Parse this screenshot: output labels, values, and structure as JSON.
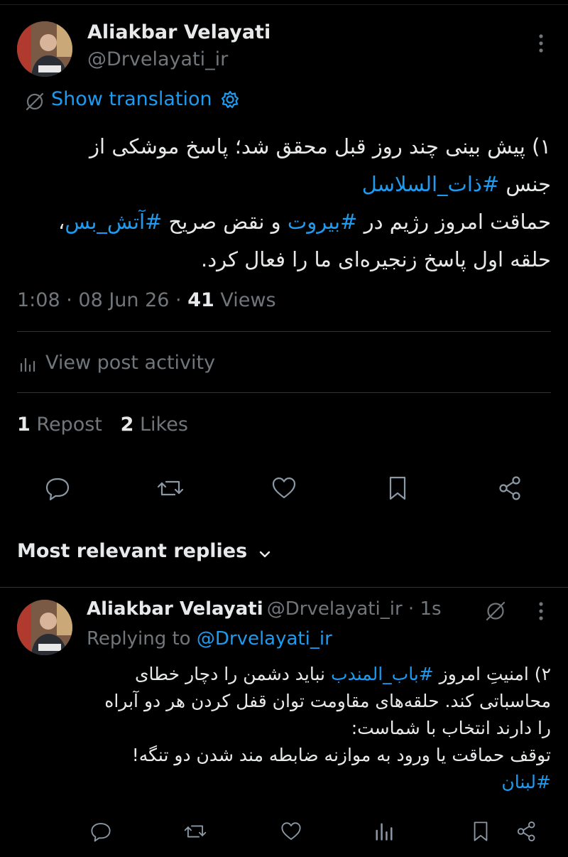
{
  "post": {
    "author_name": "Aliakbar Velayati",
    "author_handle": "@Drvelayati_ir",
    "show_translation": "Show translation",
    "text": {
      "line1": "۱) پیش بینی چند روز قبل محقق شد؛ پاسخ موشکی از",
      "line2_prefix": "جنس ",
      "line2_hashtag": "#ذات_السلاسل",
      "line3_a": "حماقت امروز رژیم در ",
      "line3_hashtag1": "#بیروت",
      "line3_b": " و نقض صریح ",
      "line3_hashtag2": "#آتش_بس",
      "line3_c": "،",
      "line4": "حلقه اول پاسخ زنجیره‌ای ما را فعال کرد."
    },
    "time": "1:08",
    "date": "08 Jun 26",
    "views_count": "41",
    "views_label": "Views",
    "view_activity": "View post activity",
    "repost_count": "1",
    "repost_label": "Repost",
    "likes_count": "2",
    "likes_label": "Likes"
  },
  "replies_header": {
    "label": "Most relevant replies"
  },
  "reply": {
    "author_name": "Aliakbar Velayati",
    "author_handle": "@Drvelayati_ir",
    "time": "1s",
    "replying_to_label": "Replying to",
    "replying_to_handle": "@Drvelayati_ir",
    "text": {
      "line1_a": "۲) امنیتِ امروز ",
      "line1_hashtag": "#باب_المندب",
      "line1_b": " نباید دشمن را دچار خطای",
      "line2": "محاسباتی کند. حلقه‌های مقاومت توان قفل کردن هر دو آبراه",
      "line3": "را دارند انتخاب با شماست:",
      "line4": "توقف حماقت یا ورود به موازنه ضابطه مند شدن دو تنگه!",
      "line5_hashtag": "#لبنان"
    }
  },
  "icons": {
    "more": "more-icon",
    "translate": "translate-icon",
    "settings": "gear-icon",
    "analytics": "analytics-icon",
    "reply": "reply-icon",
    "repost": "repost-icon",
    "like": "heart-icon",
    "bookmark": "bookmark-icon",
    "share": "share-icon",
    "chevron": "chevron-down-icon",
    "grok": "grok-icon"
  },
  "colors": {
    "background": "#000000",
    "text": "#e7e9ea",
    "secondary": "#71767b",
    "accent": "#1d9bf0",
    "divider": "#2f3336"
  }
}
